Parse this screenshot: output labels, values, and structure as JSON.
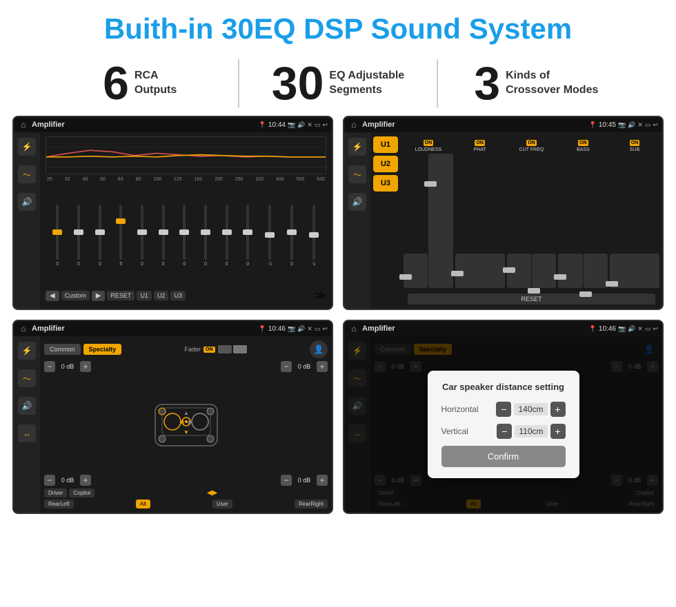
{
  "page": {
    "title": "Buith-in 30EQ DSP Sound System",
    "bg_color": "#ffffff"
  },
  "stats": [
    {
      "number": "6",
      "text": "RCA\nOutputs"
    },
    {
      "number": "30",
      "text": "EQ Adjustable\nSegments"
    },
    {
      "number": "3",
      "text": "Kinds of\nCrossover Modes"
    }
  ],
  "screens": [
    {
      "id": "screen1",
      "status_bar": {
        "title": "Amplifier",
        "time": "10:44"
      },
      "type": "eq",
      "freq_labels": [
        "25",
        "32",
        "40",
        "50",
        "63",
        "80",
        "100",
        "125",
        "160",
        "200",
        "250",
        "320",
        "400",
        "500",
        "630"
      ],
      "slider_values": [
        "0",
        "0",
        "0",
        "5",
        "0",
        "0",
        "0",
        "0",
        "0",
        "0",
        "-1",
        "0",
        "-1"
      ],
      "bottom_buttons": [
        "Custom",
        "RESET",
        "U1",
        "U2",
        "U3"
      ]
    },
    {
      "id": "screen2",
      "status_bar": {
        "title": "Amplifier",
        "time": "10:45"
      },
      "type": "amplifier",
      "u_buttons": [
        "U1",
        "U2",
        "U3"
      ],
      "channels": [
        "LOUDNESS",
        "PHAT",
        "CUT FREQ",
        "BASS",
        "SUB"
      ],
      "on_states": [
        true,
        true,
        true,
        true,
        true
      ],
      "reset_label": "RESET"
    },
    {
      "id": "screen3",
      "status_bar": {
        "title": "Amplifier",
        "time": "10:46"
      },
      "type": "speaker",
      "tabs": [
        "Common",
        "Specialty"
      ],
      "active_tab": "Specialty",
      "fader_label": "Fader",
      "fader_on": "ON",
      "db_values": [
        "0 dB",
        "0 dB",
        "0 dB",
        "0 dB"
      ],
      "location_buttons": [
        "Driver",
        "Copilot",
        "RearLeft",
        "All",
        "User",
        "RearRight"
      ]
    },
    {
      "id": "screen4",
      "status_bar": {
        "title": "Amplifier",
        "time": "10:46"
      },
      "type": "speaker_dialog",
      "tabs": [
        "Common",
        "Specialty"
      ],
      "db_values": [
        "0 dB",
        "0 dB"
      ],
      "dialog": {
        "title": "Car speaker distance setting",
        "horizontal_label": "Horizontal",
        "horizontal_value": "140cm",
        "vertical_label": "Vertical",
        "vertical_value": "110cm",
        "confirm_label": "Confirm"
      },
      "location_buttons": [
        "Driver",
        "Copilot",
        "RearLeft",
        "All",
        "User",
        "RearRight"
      ]
    }
  ]
}
